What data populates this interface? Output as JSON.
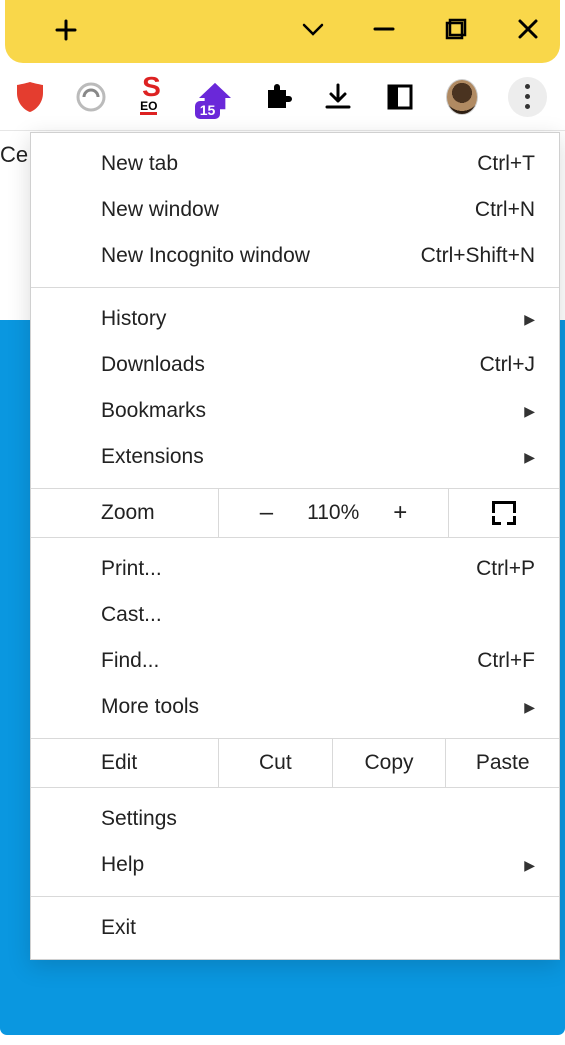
{
  "titlebar": {
    "new_tab_icon": "plus",
    "tabs_dropdown_icon": "chevron-down",
    "minimize_icon": "minimize",
    "maximize_icon": "maximize",
    "close_icon": "close"
  },
  "toolbar": {
    "extension_badge": "15"
  },
  "page_fragment": "Ce",
  "menu": {
    "new_tab": {
      "label": "New tab",
      "shortcut": "Ctrl+T"
    },
    "new_window": {
      "label": "New window",
      "shortcut": "Ctrl+N"
    },
    "new_incognito": {
      "label": "New Incognito window",
      "shortcut": "Ctrl+Shift+N"
    },
    "history": {
      "label": "History"
    },
    "downloads": {
      "label": "Downloads",
      "shortcut": "Ctrl+J"
    },
    "bookmarks": {
      "label": "Bookmarks"
    },
    "extensions": {
      "label": "Extensions"
    },
    "zoom": {
      "label": "Zoom",
      "value": "110%",
      "minus": "–",
      "plus": "+"
    },
    "print": {
      "label": "Print...",
      "shortcut": "Ctrl+P"
    },
    "cast": {
      "label": "Cast..."
    },
    "find": {
      "label": "Find...",
      "shortcut": "Ctrl+F"
    },
    "more_tools": {
      "label": "More tools"
    },
    "edit": {
      "label": "Edit",
      "cut": "Cut",
      "copy": "Copy",
      "paste": "Paste"
    },
    "settings": {
      "label": "Settings"
    },
    "help": {
      "label": "Help"
    },
    "exit": {
      "label": "Exit"
    }
  }
}
